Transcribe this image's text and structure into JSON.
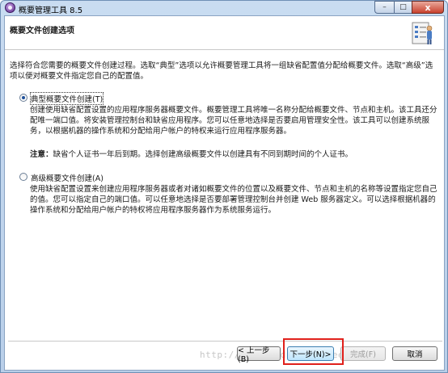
{
  "window": {
    "title": "概要管理工具 8.5"
  },
  "title_buttons": {
    "minimize": "–",
    "maximize": "□",
    "close": "x"
  },
  "banner": {
    "title": "概要文件创建选项",
    "icon": "document-checklist-icon"
  },
  "intro": "选择符合您需要的概要文件创建过程。选取“典型”选项以允许概要管理工具将一组缺省配置值分配给概要文件。选取“高级”选项以便对概要文件指定您自己的配置值。",
  "options": [
    {
      "label": "典型概要文件创建(T)",
      "selected": true,
      "description": "创建使用缺省配置设置的应用程序服务器概要文件。概要管理工具将唯一名称分配给概要文件、节点和主机。该工具还分配唯一端口值。将安装管理控制台和缺省应用程序。您可以任意地选择是否要启用管理安全性。该工具可以创建系统服务，以根据机器的操作系统和分配给用户帐户的特权来运行应用程序服务器。",
      "note_label": "注意：",
      "note_text": "缺省个人证书一年后到期。选择创建高级概要文件以创建具有不同到期时间的个人证书。"
    },
    {
      "label": "高级概要文件创建(A)",
      "selected": false,
      "description": "使用缺省配置设置来创建应用程序服务器或者对诸如概要文件的位置以及概要文件、节点和主机的名称等设置指定您自己的值。您可以指定自己的端口值。可以任意地选择是否要部署管理控制台并创建 Web 服务器定义。可以选择根据机器的操作系统和分配给用户帐户的特权将应用程序服务器作为系统服务运行。"
    }
  ],
  "buttons": {
    "back": "< 上一步(B)",
    "next": "下一步(N)>",
    "finish": "完成(F)",
    "cancel": "取消"
  },
  "watermark": "http://blog.csdn.net/greenlife"
}
